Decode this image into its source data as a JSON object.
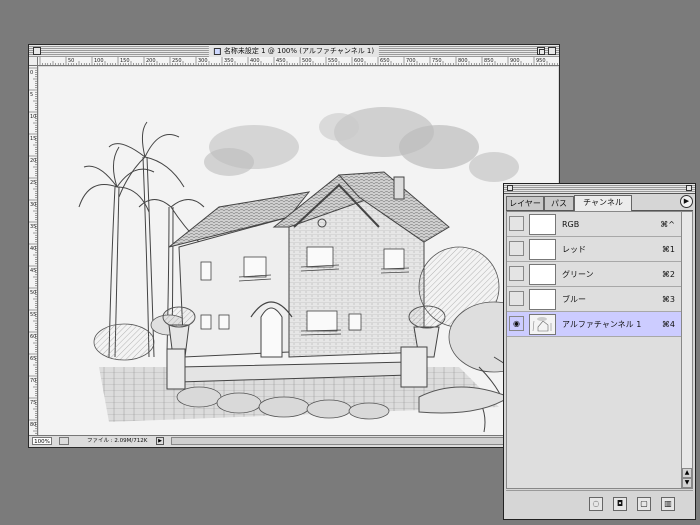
{
  "document_window": {
    "title": "名称未設定 1 @ 100% (アルファチャンネル 1)",
    "zoom": "100%",
    "file_info": "ファイル : 2.09M/712K",
    "ruler_top_labels": [
      "50",
      "100",
      "150",
      "200",
      "250",
      "300",
      "350",
      "400",
      "450",
      "500",
      "550",
      "600",
      "650",
      "700",
      "750",
      "800",
      "850",
      "900",
      "950"
    ],
    "ruler_left_labels": [
      "0",
      "5",
      "10",
      "15",
      "20",
      "25",
      "30",
      "35",
      "40",
      "45",
      "50",
      "55",
      "60",
      "65",
      "70",
      "75",
      "80"
    ]
  },
  "channels_palette": {
    "tabs": [
      {
        "label": "レイヤー",
        "active": false
      },
      {
        "label": "パス",
        "active": false
      },
      {
        "label": "チャンネル",
        "active": true
      }
    ],
    "menu_icon": "right-arrow-icon",
    "channels": [
      {
        "name": "RGB",
        "shortcut": "⌘^",
        "visible": false,
        "selected": false
      },
      {
        "name": "レッド",
        "shortcut": "⌘1",
        "visible": false,
        "selected": false
      },
      {
        "name": "グリーン",
        "shortcut": "⌘2",
        "visible": false,
        "selected": false
      },
      {
        "name": "ブルー",
        "shortcut": "⌘3",
        "visible": false,
        "selected": false
      },
      {
        "name": "アルファチャンネル 1",
        "shortcut": "⌘4",
        "visible": true,
        "selected": true
      }
    ],
    "bottom_buttons": [
      "load-selection-icon",
      "save-selection-icon",
      "new-channel-icon",
      "trash-icon"
    ]
  },
  "colors": {
    "desktop": "#7b7b7b",
    "selected_row": "#ccccff"
  }
}
